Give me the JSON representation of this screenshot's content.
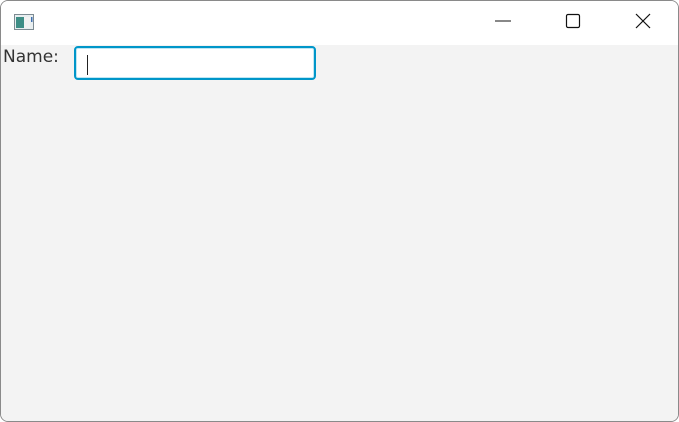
{
  "window": {
    "title": "",
    "buttons": {
      "minimize": "minimize",
      "maximize": "maximize",
      "close": "close"
    }
  },
  "form": {
    "name_label": "Name:",
    "name_value": "",
    "name_placeholder": ""
  },
  "colors": {
    "title_bar": "#ffffff",
    "content_background": "#f3f3f3",
    "focus_border": "#0096c9"
  }
}
